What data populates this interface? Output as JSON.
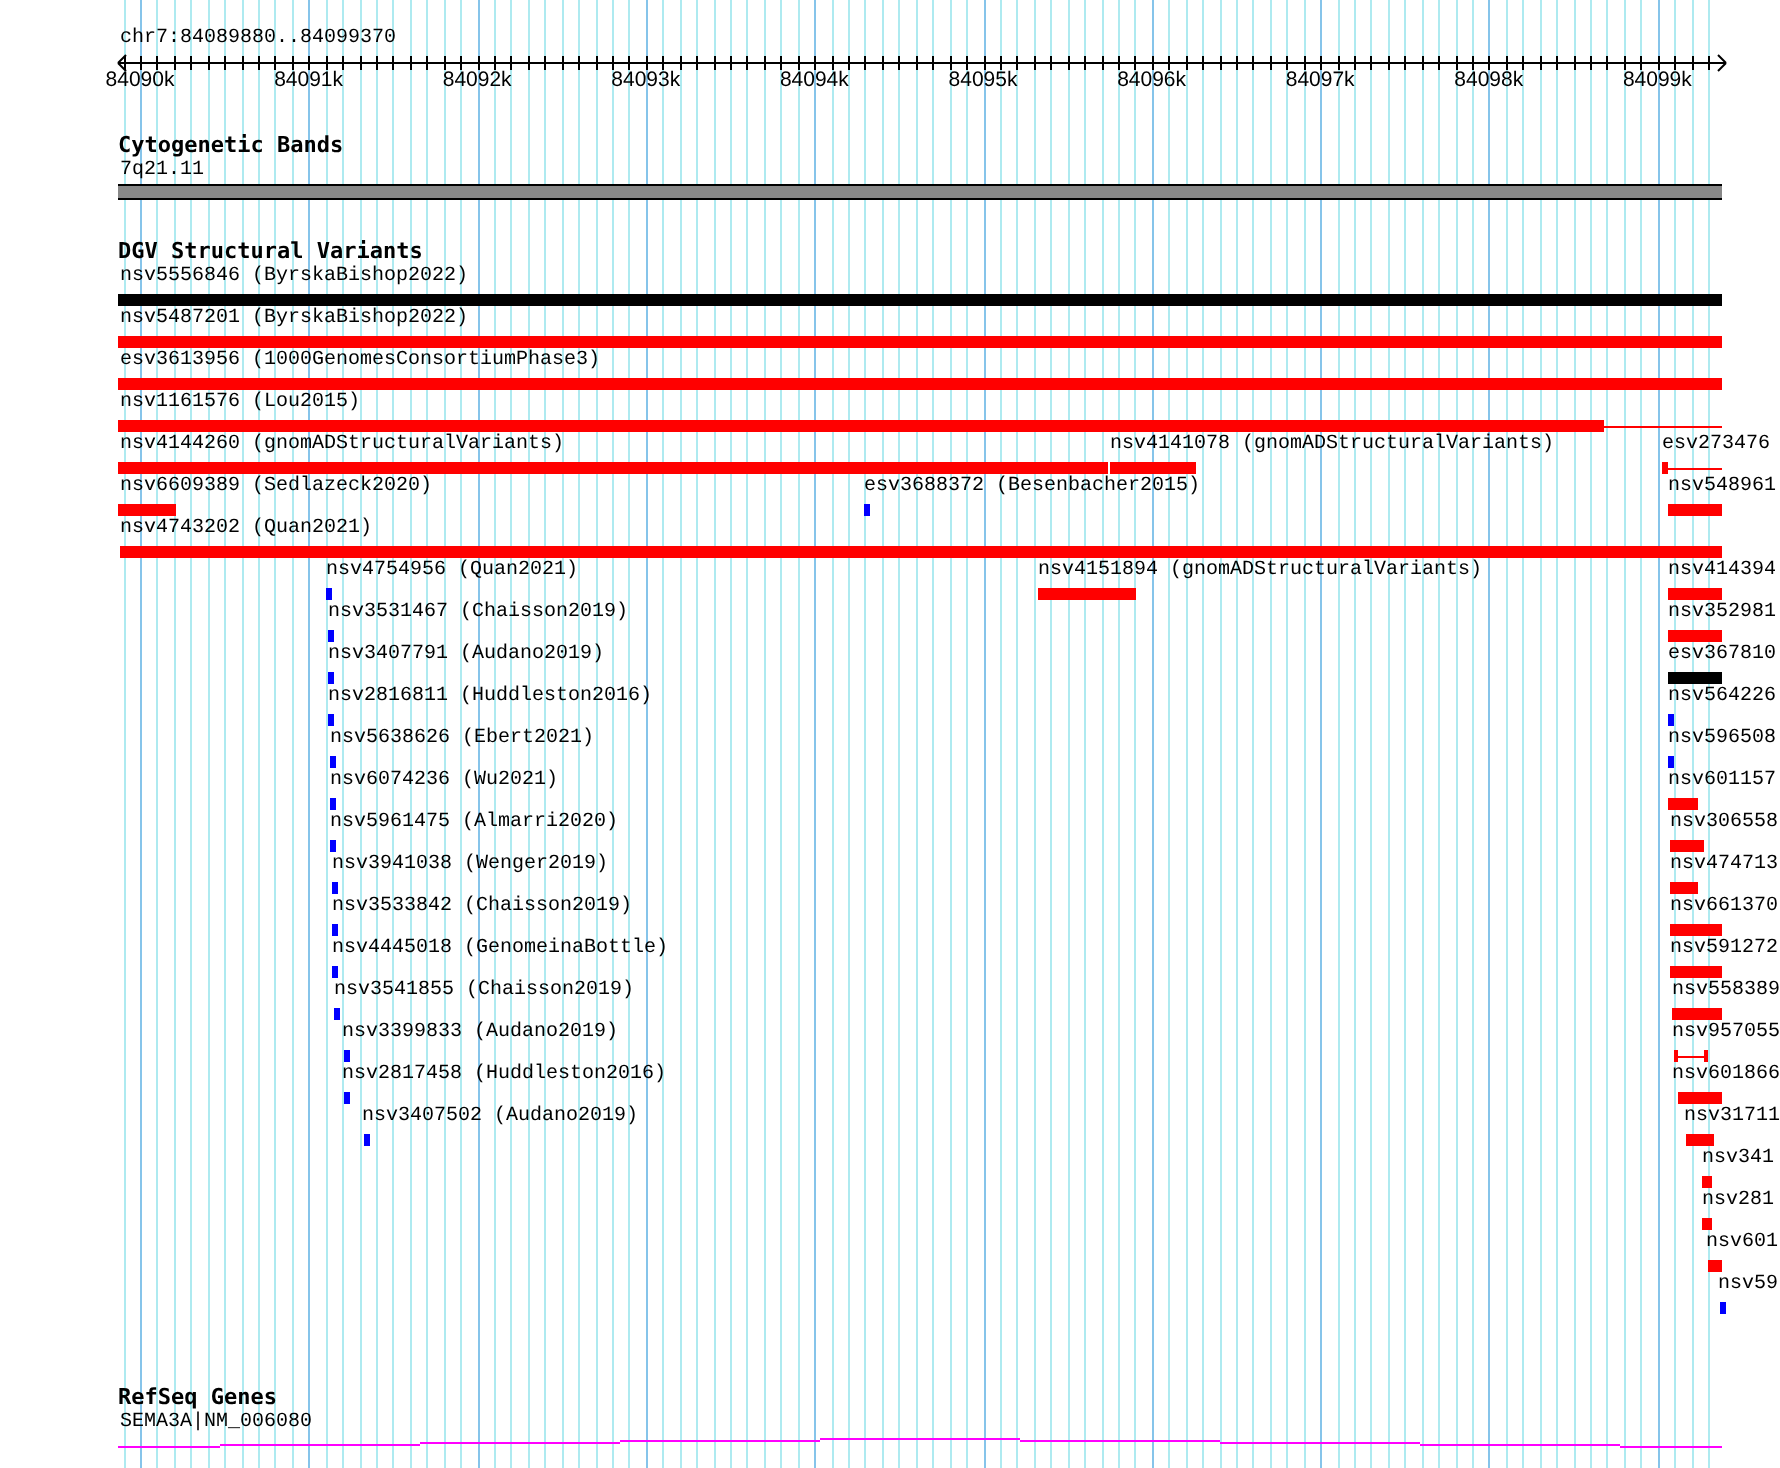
{
  "location": "chr7:84089880..84099370",
  "ruler": {
    "ticks": [
      "84090k",
      "84091k",
      "84092k",
      "84093k",
      "84094k",
      "84095k",
      "84096k",
      "84097k",
      "84098k",
      "84099k"
    ]
  },
  "tracks": [
    {
      "kind": "bands",
      "title": "Cytogenetic Bands",
      "features": [
        {
          "label": "7q21.11",
          "color": "#888888"
        }
      ]
    },
    {
      "kind": "variants",
      "title": "DGV Structural Variants",
      "features": [
        {
          "label": "nsv5556846 (ByrskaBishop2022)",
          "color": "#000000"
        },
        {
          "label": "nsv5487201 (ByrskaBishop2022)",
          "color": "#ff0000"
        },
        {
          "label": "esv3613956 (1000GenomesConsortiumPhase3)",
          "color": "#ff0000"
        },
        {
          "label": "nsv1161576 (Lou2015)",
          "color": "#ff0000"
        },
        {
          "label": "nsv4144260 (gnomADStructuralVariants)",
          "color": "#ff0000"
        },
        {
          "label": "nsv4141078 (gnomADStructuralVariants)",
          "color": "#ff0000"
        },
        {
          "label": "esv273476",
          "color": "#ff0000"
        },
        {
          "label": "nsv6609389 (Sedlazeck2020)",
          "color": "#ff0000"
        },
        {
          "label": "esv3688372 (Besenbacher2015)",
          "color": "#0000ff"
        },
        {
          "label": "nsv548961",
          "color": "#ff0000"
        },
        {
          "label": "nsv4743202 (Quan2021)",
          "color": "#ff0000"
        },
        {
          "label": "nsv4754956 (Quan2021)",
          "color": "#0000ff"
        },
        {
          "label": "nsv4151894 (gnomADStructuralVariants)",
          "color": "#ff0000"
        },
        {
          "label": "nsv414394",
          "color": "#ff0000"
        },
        {
          "label": "nsv3531467 (Chaisson2019)",
          "color": "#0000ff"
        },
        {
          "label": "nsv352981",
          "color": "#ff0000"
        },
        {
          "label": "nsv3407791 (Audano2019)",
          "color": "#0000ff"
        },
        {
          "label": "esv367810",
          "color": "#000000"
        },
        {
          "label": "nsv2816811 (Huddleston2016)",
          "color": "#0000ff"
        },
        {
          "label": "nsv564226",
          "color": "#0000ff"
        },
        {
          "label": "nsv5638626 (Ebert2021)",
          "color": "#0000ff"
        },
        {
          "label": "nsv596508",
          "color": "#0000ff"
        },
        {
          "label": "nsv6074236 (Wu2021)",
          "color": "#0000ff"
        },
        {
          "label": "nsv601157",
          "color": "#ff0000"
        },
        {
          "label": "nsv5961475 (Almarri2020)",
          "color": "#0000ff"
        },
        {
          "label": "nsv306558",
          "color": "#ff0000"
        },
        {
          "label": "nsv3941038 (Wenger2019)",
          "color": "#0000ff"
        },
        {
          "label": "nsv474713",
          "color": "#ff0000"
        },
        {
          "label": "nsv3533842 (Chaisson2019)",
          "color": "#0000ff"
        },
        {
          "label": "nsv661370",
          "color": "#ff0000"
        },
        {
          "label": "nsv4445018 (GenomeinaBottle)",
          "color": "#0000ff"
        },
        {
          "label": "nsv591272",
          "color": "#ff0000"
        },
        {
          "label": "nsv3541855 (Chaisson2019)",
          "color": "#0000ff"
        },
        {
          "label": "nsv558389",
          "color": "#ff0000"
        },
        {
          "label": "nsv3399833 (Audano2019)",
          "color": "#0000ff"
        },
        {
          "label": "nsv957055",
          "color": "#ff0000"
        },
        {
          "label": "nsv2817458 (Huddleston2016)",
          "color": "#0000ff"
        },
        {
          "label": "nsv601866",
          "color": "#ff0000"
        },
        {
          "label": "nsv3407502 (Audano2019)",
          "color": "#0000ff"
        },
        {
          "label": "nsv31711",
          "color": "#ff0000"
        },
        {
          "label": "nsv341",
          "color": "#ff0000"
        },
        {
          "label": "nsv281",
          "color": "#ff0000"
        },
        {
          "label": "nsv601",
          "color": "#ff0000"
        },
        {
          "label": "nsv59",
          "color": "#0000ff"
        }
      ]
    },
    {
      "kind": "genes",
      "title": "RefSeq Genes",
      "features": [
        {
          "label": "SEMA3A|NM_006080",
          "color": "#ff00ff"
        }
      ]
    }
  ]
}
